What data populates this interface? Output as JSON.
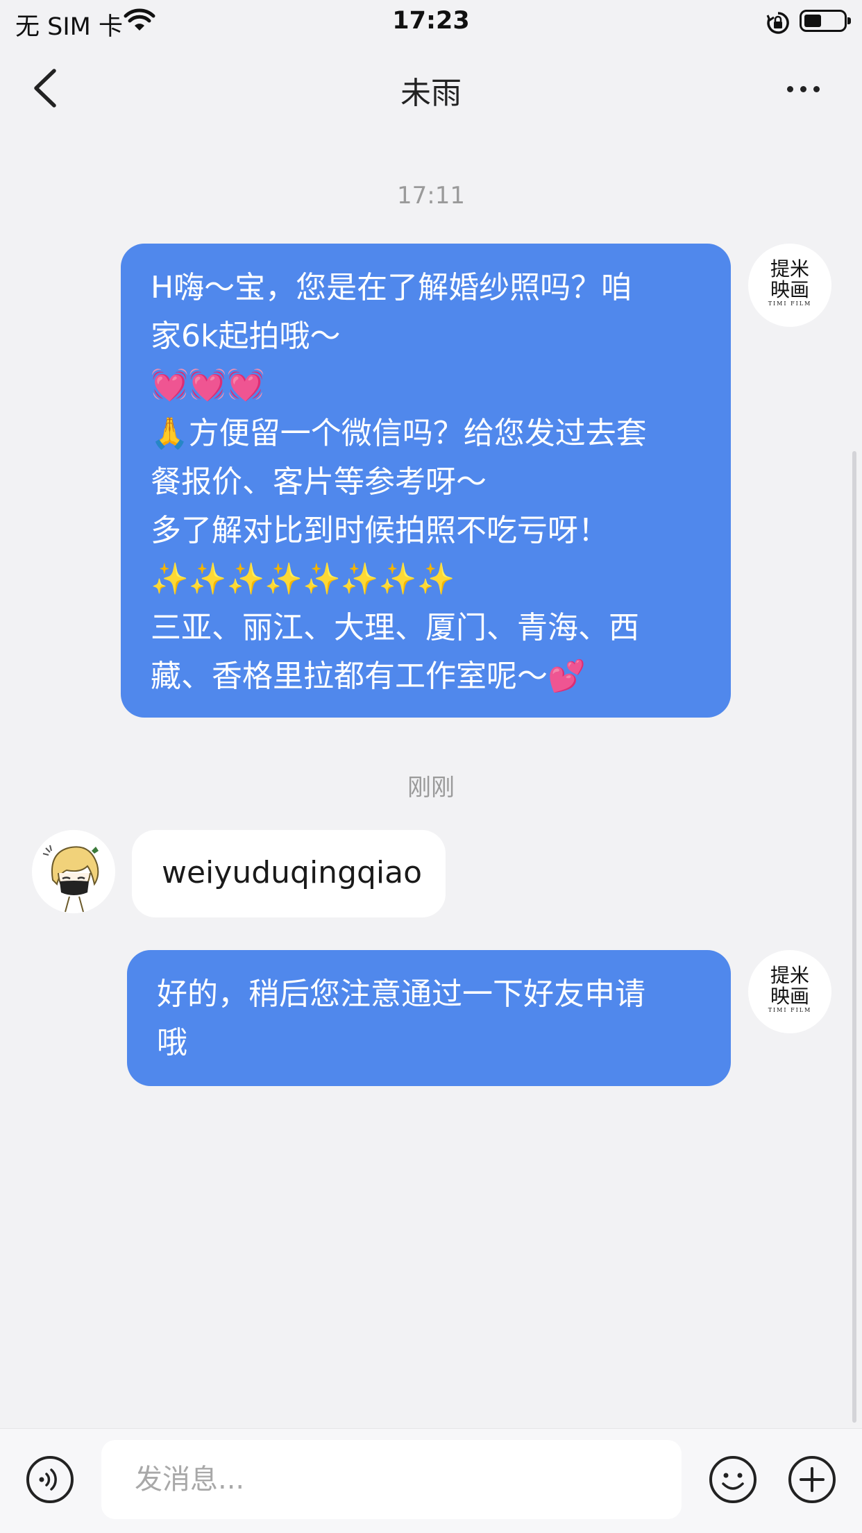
{
  "status_bar": {
    "carrier": "无 SIM 卡",
    "time": "17:23"
  },
  "header": {
    "title": "未雨",
    "back_icon": "chevron-left-icon",
    "more_icon": "ellipsis-icon"
  },
  "messages": [
    {
      "timestamp": "17:11",
      "direction": "outgoing",
      "sender_logo": {
        "line1": "提米",
        "line2": "映画",
        "line3": "TIMI FILM"
      },
      "lines": [
        "H嗨～宝，您是在了解婚纱照吗？咱",
        "家6k起拍哦～",
        "💓💓💓",
        "🙏方便留一个微信吗？给您发过去套",
        "餐报价、客片等参考呀～",
        "多了解对比到时候拍照不吃亏呀！",
        "✨✨✨✨✨✨✨✨",
        "三亚、丽江、大理、厦门、青海、西",
        "藏、香格里拉都有工作室呢～💕"
      ]
    },
    {
      "timestamp": "刚刚",
      "direction": "incoming",
      "text": "weiyuduqingqiao"
    },
    {
      "direction": "outgoing",
      "sender_logo": {
        "line1": "提米",
        "line2": "映画",
        "line3": "TIMI FILM"
      },
      "lines": [
        "好的，稍后您注意通过一下好友申请",
        "哦"
      ]
    }
  ],
  "input_bar": {
    "placeholder": "发消息...",
    "voice_icon": "voice-icon",
    "emoji_icon": "emoji-icon",
    "add_icon": "plus-icon"
  },
  "colors": {
    "outgoing_bubble": "#5088ec",
    "incoming_bubble": "#ffffff",
    "background": "#f2f2f4"
  }
}
